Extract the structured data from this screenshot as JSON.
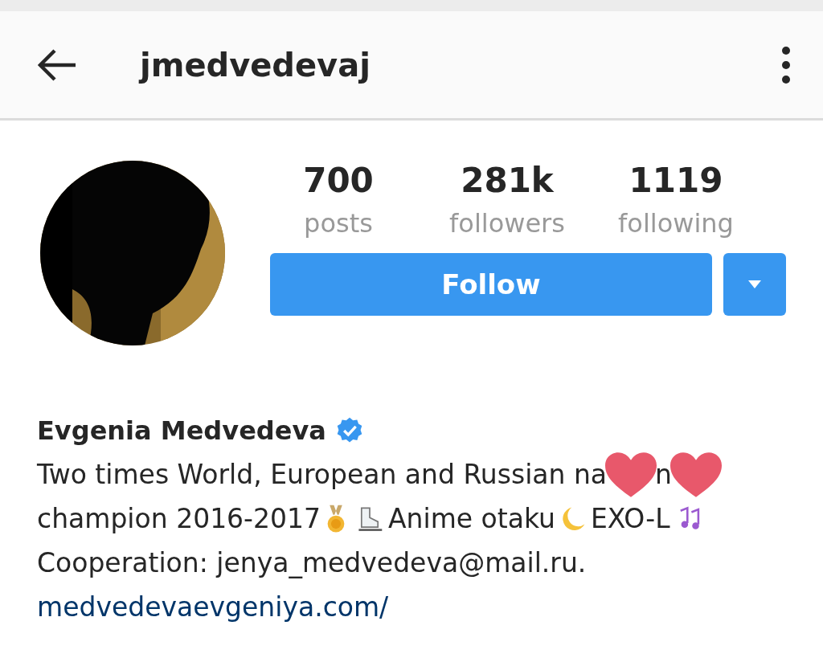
{
  "header": {
    "username": "jmedvedevaj"
  },
  "stats": [
    {
      "count": "700",
      "label": "posts"
    },
    {
      "count": "281k",
      "label": "followers"
    },
    {
      "count": "1119",
      "label": "following"
    }
  ],
  "follow_button": {
    "label": "Follow"
  },
  "profile": {
    "name": "Evgenia Medvedeva",
    "verified": true
  },
  "bio": {
    "line_1": "Two times World, European and Russian na",
    "line_1_tail": "n",
    "line_2": [
      "champion 2016-2017",
      "Anime otaku",
      "EXO-L"
    ],
    "contact": "Cooperation: jenya_medvedeva@mail.ru.",
    "website": "medvedevaevgeniya.com/"
  }
}
